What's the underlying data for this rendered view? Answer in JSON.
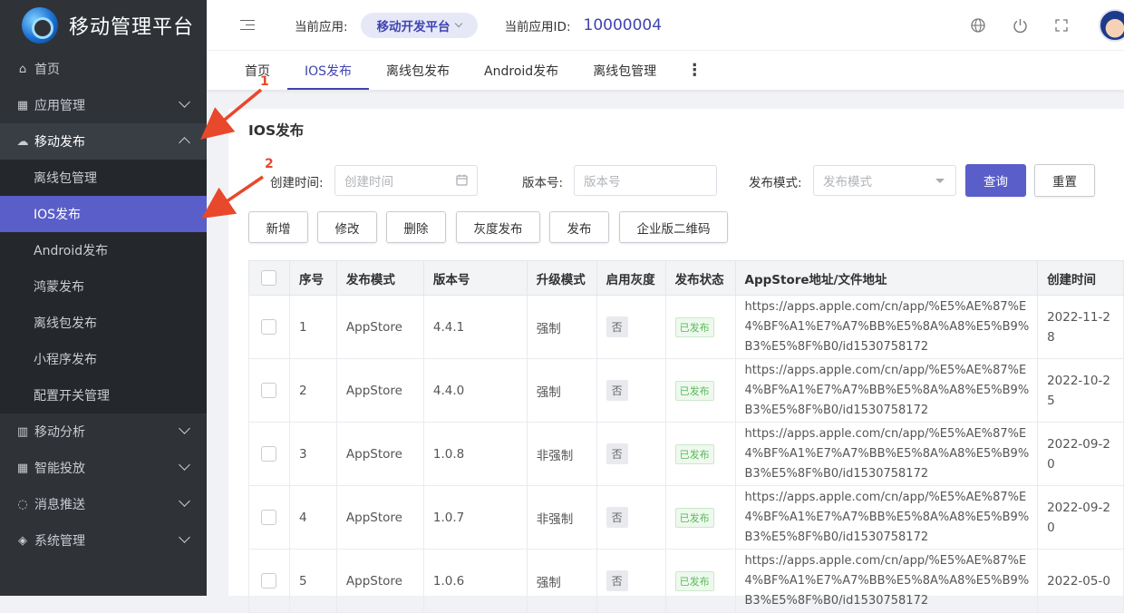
{
  "sidebar": {
    "logo_text": "移动管理平台",
    "menu": [
      {
        "label": "首页",
        "icon": "home-icon"
      },
      {
        "label": "应用管理",
        "icon": "grid-icon"
      },
      {
        "label": "移动发布",
        "icon": "cloud-upload-icon"
      }
    ],
    "sub_items": [
      "离线包管理",
      "IOS发布",
      "Android发布",
      "鸿蒙发布",
      "离线包发布",
      "小程序发布",
      "配置开关管理"
    ],
    "menu_bottom": [
      {
        "label": "移动分析",
        "icon": "bar-chart-icon"
      },
      {
        "label": "智能投放",
        "icon": "grid-icon"
      },
      {
        "label": "消息推送",
        "icon": "message-icon"
      },
      {
        "label": "系统管理",
        "icon": "layers-icon"
      }
    ]
  },
  "header": {
    "current_app_label": "当前应用:",
    "current_app_value": "移动开发平台",
    "app_id_label": "当前应用ID:",
    "app_id_value": "10000004"
  },
  "tabs": [
    "首页",
    "IOS发布",
    "离线包发布",
    "Android发布",
    "离线包管理"
  ],
  "page": {
    "title": "IOS发布",
    "filters": {
      "create_time_label": "创建时间:",
      "create_time_placeholder": "创建时间",
      "version_label": "版本号:",
      "version_placeholder": "版本号",
      "mode_label": "发布模式:",
      "mode_placeholder": "发布模式",
      "query": "查询",
      "reset": "重置"
    },
    "actions": [
      "新增",
      "修改",
      "删除",
      "灰度发布",
      "发布",
      "企业版二维码"
    ]
  },
  "table": {
    "headers": [
      "序号",
      "发布模式",
      "版本号",
      "升级模式",
      "启用灰度",
      "发布状态",
      "AppStore地址/文件地址",
      "创建时间"
    ],
    "rows": [
      {
        "no": "1",
        "mode": "AppStore",
        "version": "4.4.1",
        "upgrade": "强制",
        "gray": "否",
        "status": "已发布",
        "url": "https://apps.apple.com/cn/app/%E5%AE%87%E4%BF%A1%E7%A7%BB%E5%8A%A8%E5%B9%B3%E5%8F%B0/id1530758172",
        "created": "2022-11-28"
      },
      {
        "no": "2",
        "mode": "AppStore",
        "version": "4.4.0",
        "upgrade": "强制",
        "gray": "否",
        "status": "已发布",
        "url": "https://apps.apple.com/cn/app/%E5%AE%87%E4%BF%A1%E7%A7%BB%E5%8A%A8%E5%B9%B3%E5%8F%B0/id1530758172",
        "created": "2022-10-25"
      },
      {
        "no": "3",
        "mode": "AppStore",
        "version": "1.0.8",
        "upgrade": "非强制",
        "gray": "否",
        "status": "已发布",
        "url": "https://apps.apple.com/cn/app/%E5%AE%87%E4%BF%A1%E7%A7%BB%E5%8A%A8%E5%B9%B3%E5%8F%B0/id1530758172",
        "created": "2022-09-20"
      },
      {
        "no": "4",
        "mode": "AppStore",
        "version": "1.0.7",
        "upgrade": "非强制",
        "gray": "否",
        "status": "已发布",
        "url": "https://apps.apple.com/cn/app/%E5%AE%87%E4%BF%A1%E7%A7%BB%E5%8A%A8%E5%B9%B3%E5%8F%B0/id1530758172",
        "created": "2022-09-20"
      },
      {
        "no": "5",
        "mode": "AppStore",
        "version": "1.0.6",
        "upgrade": "强制",
        "gray": "否",
        "status": "已发布",
        "url": "https://apps.apple.com/cn/app/%E5%AE%87%E4%BF%A1%E7%A7%BB%E5%8A%A8%E5%B9%B3%E5%8F%B0/id1530758172",
        "created": "2022-05-0"
      }
    ]
  },
  "annotations": [
    "1",
    "2"
  ],
  "colors": {
    "accent": "#5a5ec9",
    "sidebar_bg": "#2f3338",
    "annotation": "#e8482b"
  }
}
